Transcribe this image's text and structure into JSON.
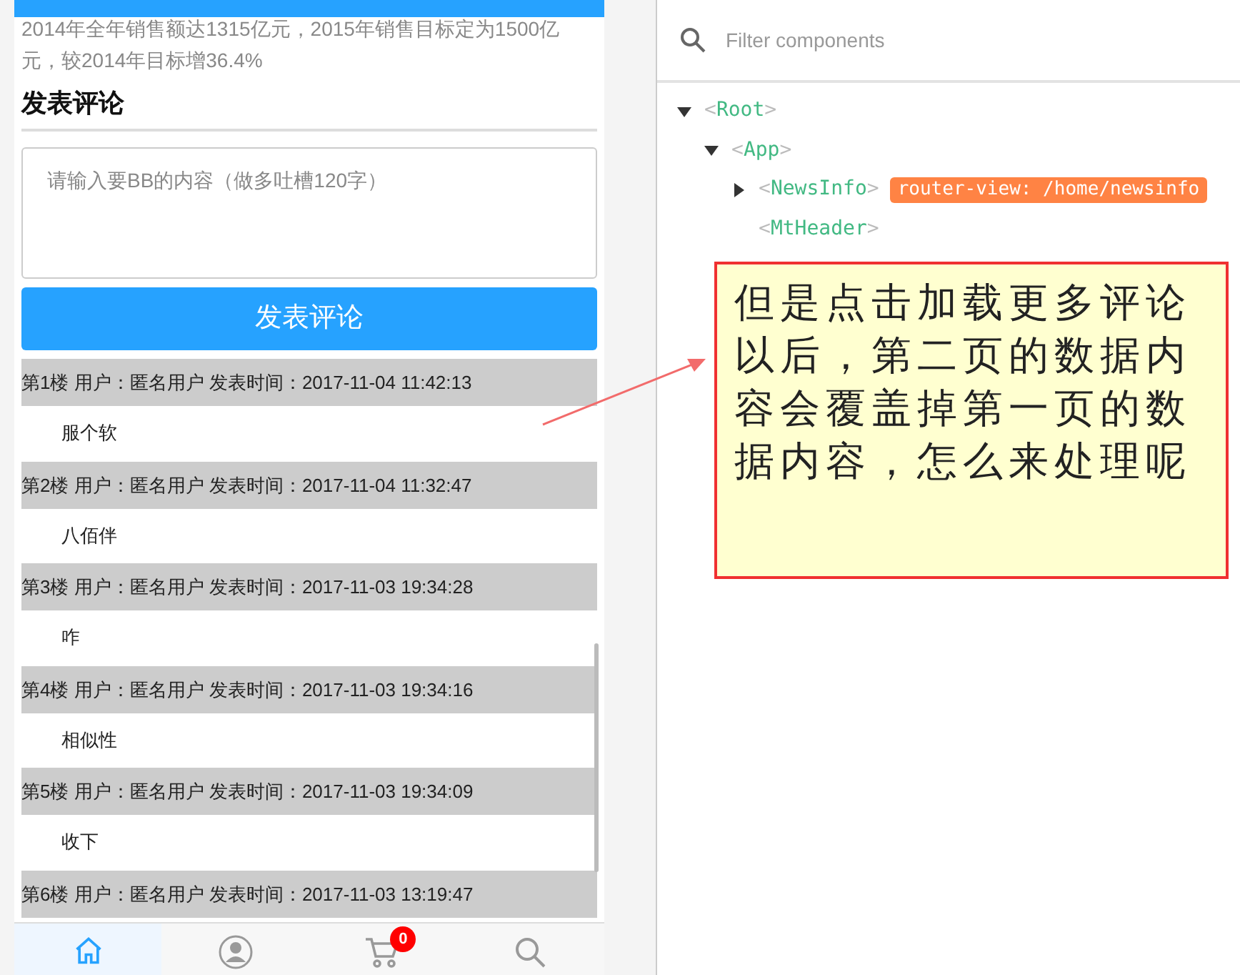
{
  "article": {
    "text": "2014年全年销售额达1315亿元，2015年销售目标定为1500亿元，较2014年目标增36.4%"
  },
  "comment_form": {
    "title": "发表评论",
    "placeholder": "请输入要BB的内容（做多吐槽120字）",
    "submit": "发表评论"
  },
  "comments": [
    {
      "header": "第1楼  用户：匿名用户  发表时间：2017-11-04 11:42:13",
      "body": "服个软"
    },
    {
      "header": "第2楼  用户：匿名用户  发表时间：2017-11-04 11:32:47",
      "body": "八佰伴"
    },
    {
      "header": "第3楼  用户：匿名用户  发表时间：2017-11-03 19:34:28",
      "body": "咋"
    },
    {
      "header": "第4楼  用户：匿名用户  发表时间：2017-11-03 19:34:16",
      "body": "相似性"
    },
    {
      "header": "第5楼  用户：匿名用户  发表时间：2017-11-03 19:34:09",
      "body": "收下"
    },
    {
      "header": "第6楼  用户：匿名用户  发表时间：2017-11-03 13:19:47"
    }
  ],
  "tabbar": [
    {
      "kind": "home",
      "selected": true
    },
    {
      "kind": "user",
      "selected": false
    },
    {
      "kind": "cart",
      "selected": false,
      "badge": "0"
    },
    {
      "kind": "search",
      "selected": false
    }
  ],
  "devtools": {
    "filter_placeholder": "Filter components",
    "tree": [
      {
        "open": "<",
        "name": "Root",
        "close": ">",
        "expanded": true,
        "children": [
          {
            "open": "<",
            "name": "App",
            "close": ">",
            "expanded": true,
            "children": [
              {
                "open": "<",
                "name": "NewsInfo",
                "close": ">",
                "expanded": false,
                "tag": "router-view: /home/newsinfo"
              },
              {
                "open": "<",
                "name": "MtHeader",
                "close": ">"
              }
            ]
          }
        ]
      }
    ]
  },
  "callout": {
    "text": "但是点击加载更多评论以后，第二页的数据内容会覆盖掉第一页的数据内容，怎么来处理呢"
  }
}
